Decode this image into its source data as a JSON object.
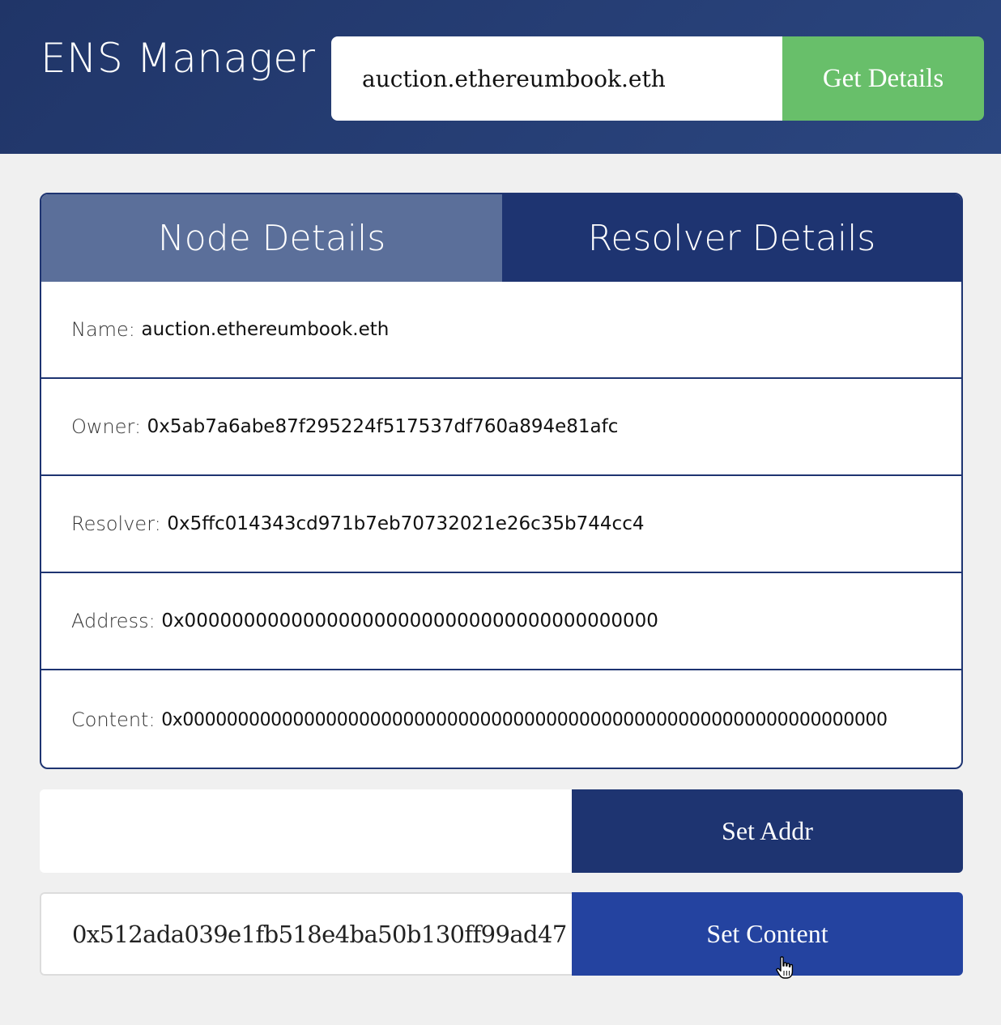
{
  "header": {
    "title": "ENS Manager",
    "search_value": "auction.ethereumbook.eth",
    "get_details_label": "Get Details"
  },
  "tabs": [
    {
      "label": "Node Details"
    },
    {
      "label": "Resolver Details"
    }
  ],
  "details": {
    "name": {
      "label": "Name:",
      "value": "auction.ethereumbook.eth"
    },
    "owner": {
      "label": "Owner:",
      "value": "0x5ab7a6abe87f295224f517537df760a894e81afc"
    },
    "resolver": {
      "label": "Resolver:",
      "value": "0x5ffc014343cd971b7eb70732021e26c35b744cc4"
    },
    "address": {
      "label": "Address:",
      "value": "0x0000000000000000000000000000000000000000"
    },
    "content": {
      "label": "Content:",
      "value": "0x0000000000000000000000000000000000000000000000000000000000000000"
    }
  },
  "actions": {
    "addr_input_value": "",
    "set_addr_label": "Set Addr",
    "content_input_value": "0x512ada039e1fb518e4ba50b130ff99ad47",
    "set_content_label": "Set Content"
  },
  "colors": {
    "header_bg": "#203568",
    "accent_green": "#68bf6a",
    "navy": "#1e3471",
    "tab_inactive": "#5b6f9a",
    "button_blue": "#2443a0"
  },
  "cursor": {
    "icon": "hand-pointer-icon"
  }
}
